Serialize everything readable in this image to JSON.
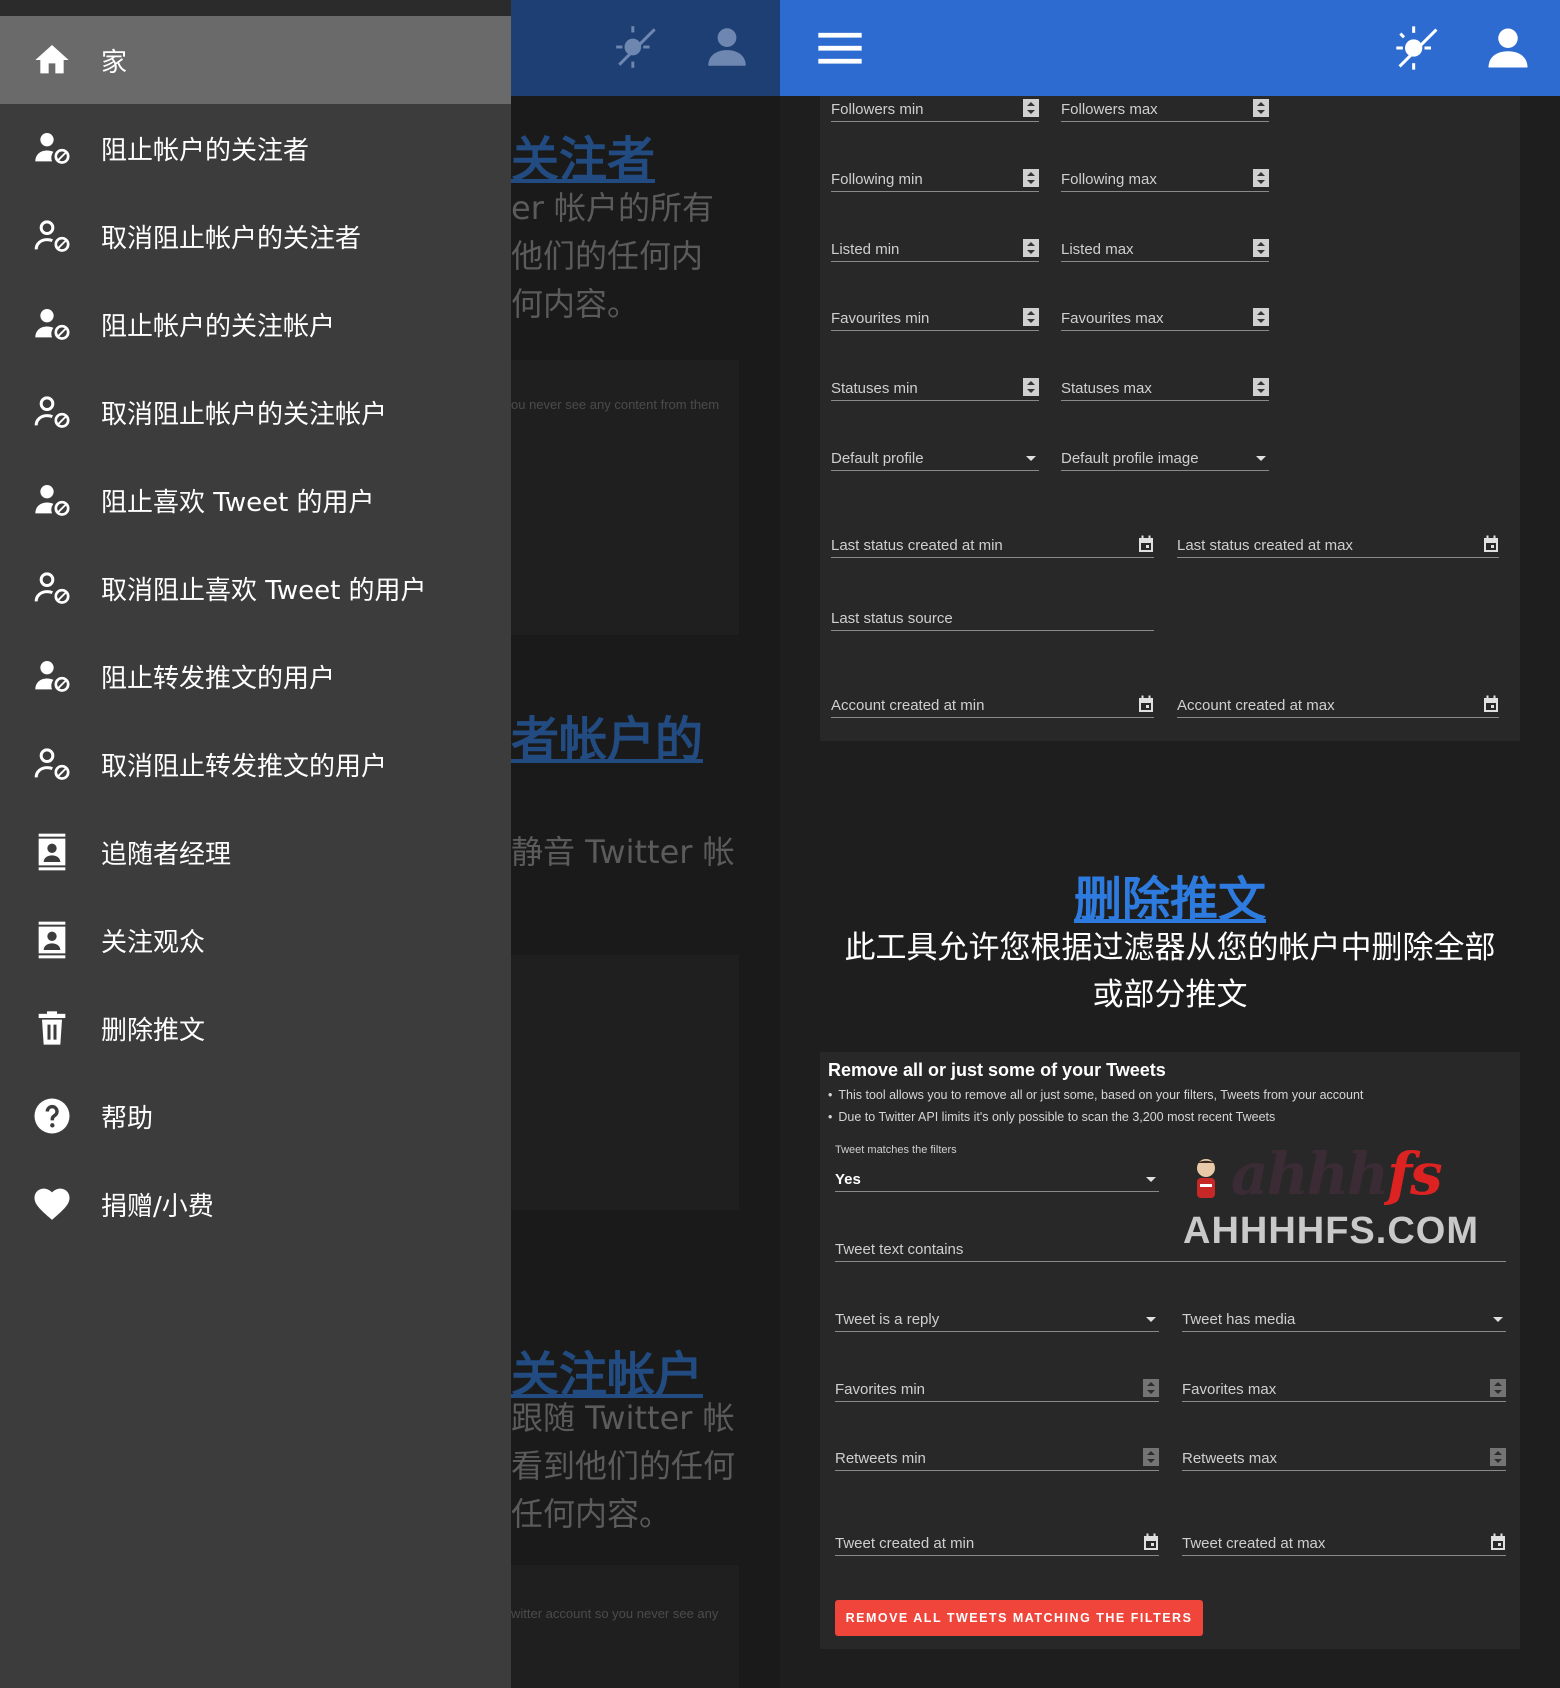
{
  "drawer": {
    "items": [
      {
        "label": "家",
        "icon": "home-icon",
        "active": true
      },
      {
        "label": "阻止帐户的关注者",
        "icon": "person-block-icon"
      },
      {
        "label": "取消阻止帐户的关注者",
        "icon": "person-unblock-icon"
      },
      {
        "label": "阻止帐户的关注帐户",
        "icon": "person-block-icon"
      },
      {
        "label": "取消阻止帐户的关注帐户",
        "icon": "person-unblock-icon"
      },
      {
        "label": "阻止喜欢 Tweet 的用户",
        "icon": "person-block-icon"
      },
      {
        "label": "取消阻止喜欢 Tweet 的用户",
        "icon": "person-unblock-icon"
      },
      {
        "label": "阻止转发推文的用户",
        "icon": "person-block-icon"
      },
      {
        "label": "取消阻止转发推文的用户",
        "icon": "person-unblock-icon"
      },
      {
        "label": "追随者经理",
        "icon": "contact-card-icon"
      },
      {
        "label": "关注观众",
        "icon": "contact-card-icon"
      },
      {
        "label": "删除推文",
        "icon": "trash-icon"
      },
      {
        "label": "帮助",
        "icon": "help-icon"
      },
      {
        "label": "捐赠/小费",
        "icon": "heart-icon"
      }
    ]
  },
  "background_page": {
    "heading1": "关注者",
    "text1": [
      "er 帐户的所有",
      "他们的任何内",
      "何内容。"
    ],
    "small1": "ou never see any content from them",
    "heading2": "者帐户的",
    "text2": "静音 Twitter 帐",
    "heading3": "关注帐户",
    "text3": [
      "跟随 Twitter 帐",
      "看到他们的任何",
      "任何内容。"
    ],
    "small2": "witter account so you never see any"
  },
  "filters_top": {
    "rows": [
      [
        "Followers min",
        "Followers max"
      ],
      [
        "Following min",
        "Following max"
      ],
      [
        "Listed min",
        "Listed max"
      ],
      [
        "Favourites min",
        "Favourites max"
      ],
      [
        "Statuses min",
        "Statuses max"
      ]
    ],
    "dropdowns": [
      "Default profile",
      "Default profile image"
    ],
    "last_status_min": "Last status created at min",
    "last_status_max": "Last status created at max",
    "last_status_source": "Last status source",
    "account_min": "Account created at min",
    "account_max": "Account created at max"
  },
  "delete_section": {
    "title": "删除推文",
    "description": "此工具允许您根据过滤器从您的帐户中删除全部或部分推文",
    "card_title": "Remove all or just some of your Tweets",
    "bullets": [
      "This tool allows you to remove all or just some, based on your filters, Tweets from your account",
      "Due to Twitter API limits it's only possible to scan the 3,200 most recent Tweets"
    ],
    "matches_label": "Tweet matches the filters",
    "matches_value": "Yes",
    "text_contains": "Tweet text contains",
    "is_reply": "Tweet is a reply",
    "has_media": "Tweet has media",
    "favorites_min": "Favorites min",
    "favorites_max": "Favorites max",
    "retweets_min": "Retweets min",
    "retweets_max": "Retweets max",
    "created_min": "Tweet created at min",
    "created_max": "Tweet created at max",
    "button": "REMOVE ALL TWEETS MATCHING THE FILTERS"
  },
  "watermark": {
    "script_dark": "ahhh",
    "script_red": "fs",
    "domain": "AHHHHFS.COM"
  },
  "colors": {
    "appbar": "#2d6bd0",
    "drawer": "#3c3c3c",
    "link": "#2e7be0",
    "danger_button": "#f0453a"
  }
}
